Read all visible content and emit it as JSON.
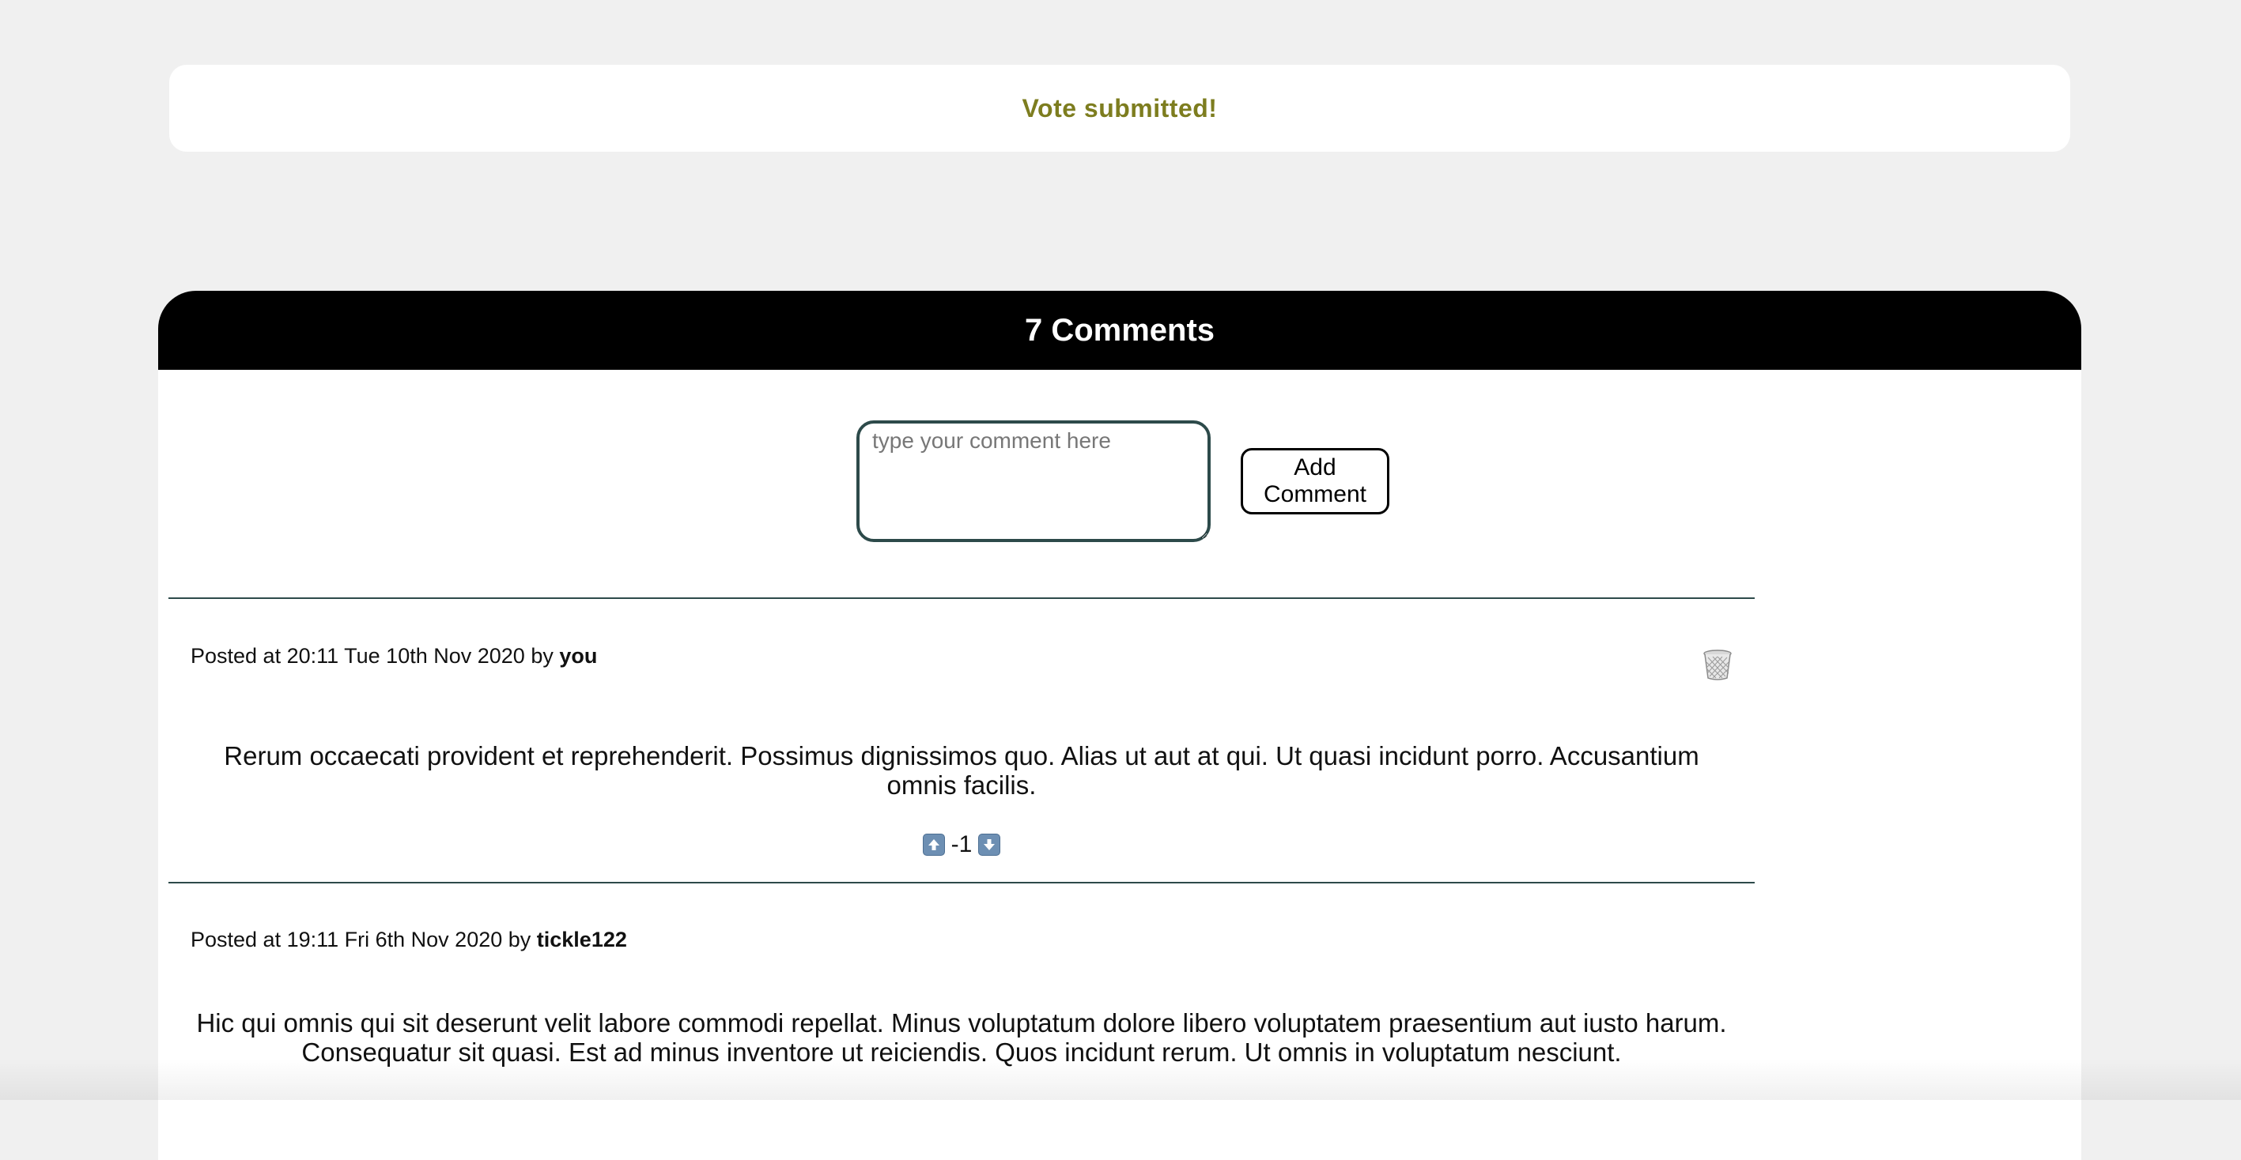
{
  "notice": {
    "text": "Vote submitted!"
  },
  "comments": {
    "title": "7 Comments",
    "compose": {
      "placeholder": "type your comment here",
      "add_label": "Add Comment"
    },
    "items": [
      {
        "meta_prefix": "Posted at 20:11 Tue 10th Nov 2020 by",
        "author": "you",
        "body": "Rerum occaecati provident et reprehenderit. Possimus dignissimos quo. Alias ut aut at qui. Ut quasi incidunt porro. Accusantium omnis facilis.",
        "votes": "-1",
        "deletable": true
      },
      {
        "meta_prefix": "Posted at 19:11 Fri 6th Nov 2020 by",
        "author": "tickle122",
        "body": "Hic qui omnis qui sit deserunt velit labore commodi repellat. Minus voluptatum dolore libero voluptatem praesentium aut iusto harum. Consequatur sit quasi. Est ad minus inventore ut reiciendis. Quos incidunt rerum. Ut omnis in voluptatum nesciunt."
      }
    ]
  },
  "icons": {
    "delete": "trash-icon",
    "upvote": "arrow-up-icon",
    "downvote": "arrow-down-icon"
  },
  "colors": {
    "notice_text": "#7d7d1f",
    "header_bg": "#000000",
    "divider": "#2d4a4a",
    "vote_button": "#6d8fb3"
  }
}
